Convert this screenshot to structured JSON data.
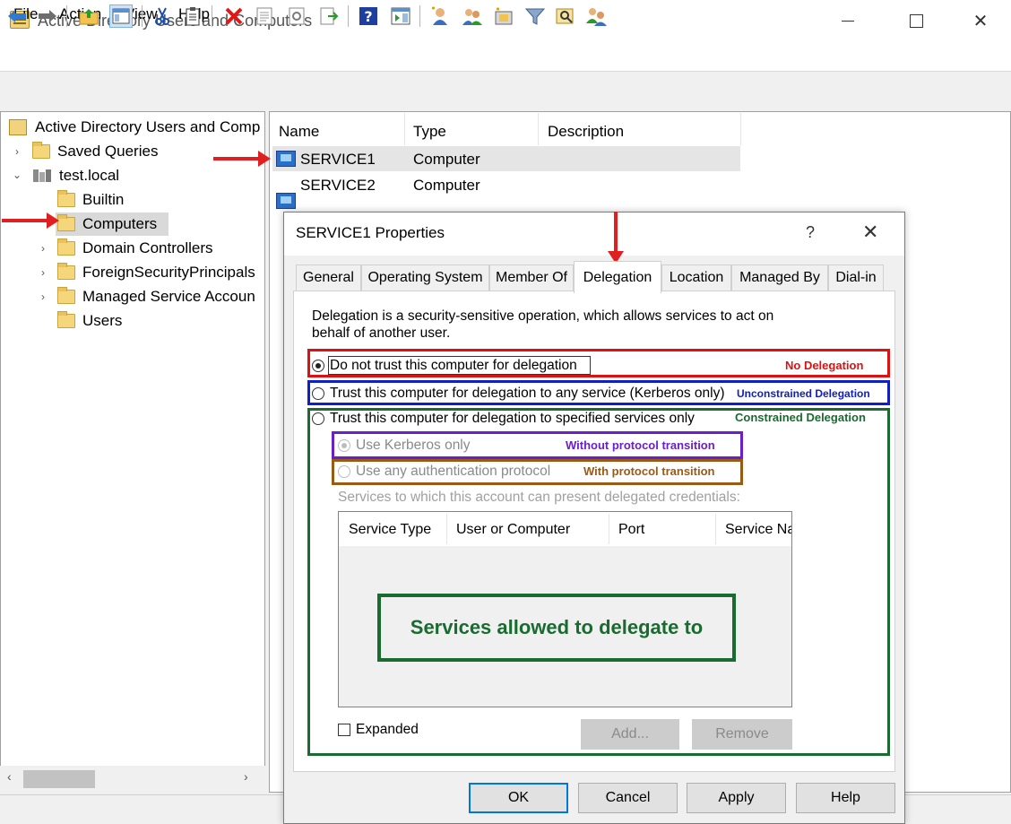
{
  "window": {
    "title": "Active Directory Users and Computers"
  },
  "menu": [
    "File",
    "Action",
    "View",
    "Help"
  ],
  "toolbar": {
    "icons": [
      "back-arrow-icon",
      "forward-arrow-icon",
      "up-folder-icon",
      "show-console-tree-icon",
      "cut-icon",
      "copy-icon",
      "delete-icon",
      "properties-icon",
      "refresh-icon",
      "export-list-icon",
      "help-icon",
      "show-action-pane-icon",
      "new-user-icon",
      "new-group-icon",
      "new-ou-icon",
      "filter-icon",
      "find-icon",
      "delegate-control-icon"
    ]
  },
  "tree": {
    "root": "Active Directory Users and Comp",
    "items": [
      {
        "label": "Saved Queries",
        "expander": "›"
      },
      {
        "label": "test.local",
        "expander": "⌄"
      },
      {
        "label": "Builtin",
        "expander": ""
      },
      {
        "label": "Computers",
        "expander": ""
      },
      {
        "label": "Domain Controllers",
        "expander": "›"
      },
      {
        "label": "ForeignSecurityPrincipals",
        "expander": "›"
      },
      {
        "label": "Managed Service Accoun",
        "expander": "›"
      },
      {
        "label": "Users",
        "expander": ""
      }
    ]
  },
  "list": {
    "columns": [
      "Name",
      "Type",
      "Description"
    ],
    "rows": [
      {
        "name": "SERVICE1",
        "type": "Computer",
        "description": ""
      },
      {
        "name": "SERVICE2",
        "type": "Computer",
        "description": ""
      }
    ]
  },
  "dialog": {
    "title": "SERVICE1 Properties",
    "help": "?",
    "close": "✕",
    "tabs": [
      "General",
      "Operating System",
      "Member Of",
      "Delegation",
      "Location",
      "Managed By",
      "Dial-in"
    ],
    "active_tab": "Delegation",
    "description": "Delegation is a security-sensitive operation, which allows services to act on behalf of another user.",
    "options": {
      "no_trust": "Do not trust this computer for delegation",
      "trust_any": "Trust this computer for delegation to any service (Kerberos only)",
      "trust_specified": "Trust this computer for delegation to specified services only",
      "kerberos_only": "Use Kerberos only",
      "any_protocol": "Use any authentication protocol"
    },
    "selected_option": "no_trust",
    "services_label": "Services to which this account can present delegated credentials:",
    "services_columns": [
      "Service Type",
      "User or Computer",
      "Port",
      "Service Na"
    ],
    "expanded_label": "Expanded",
    "add_label": "Add...",
    "remove_label": "Remove",
    "ok_label": "OK",
    "cancel_label": "Cancel",
    "apply_label": "Apply",
    "help_label": "Help"
  },
  "annotations": {
    "no_delegation": "No Delegation",
    "unconstrained": "Unconstrained Delegation",
    "constrained": "Constrained Delegation",
    "without_pt": "Without protocol transition",
    "with_pt": "With protocol transition",
    "services_note": "Services allowed to delegate to"
  },
  "colors": {
    "red": "#e01010",
    "blue": "#1020c0",
    "green": "#1a6b30",
    "purple": "#6a20c8",
    "brown": "#9a5a14"
  }
}
